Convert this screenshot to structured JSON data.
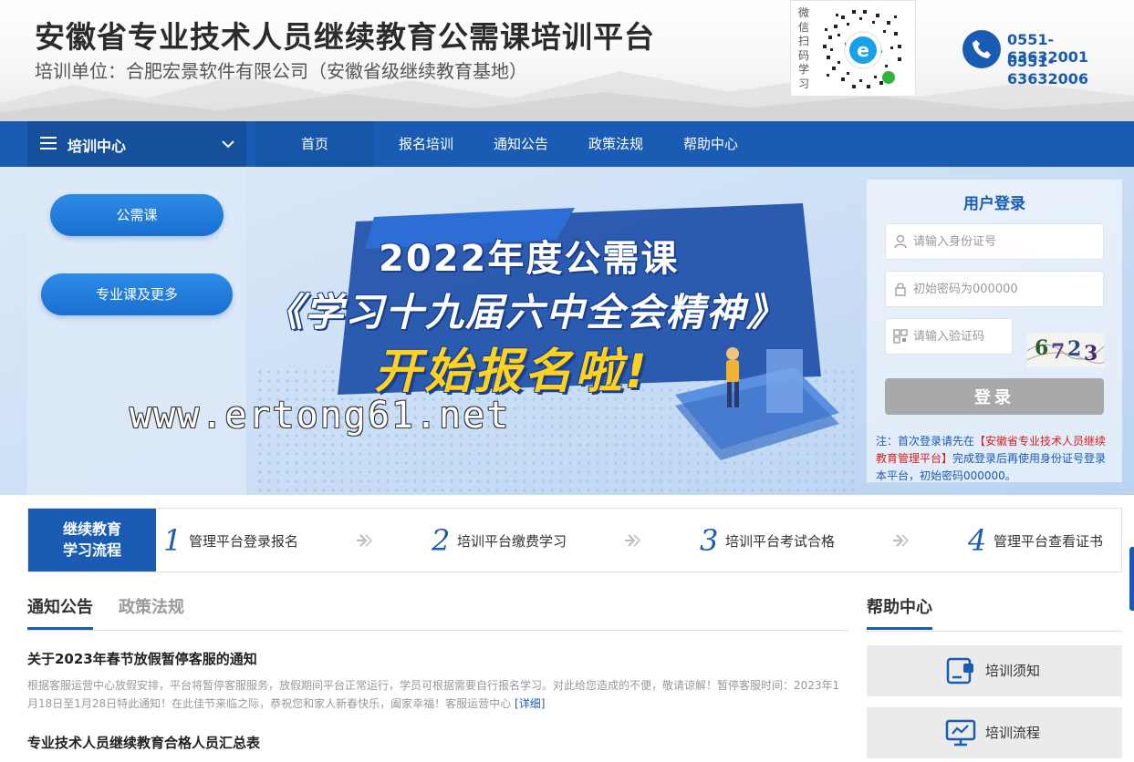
{
  "header": {
    "title": "安徽省专业技术人员继续教育公需课培训平台",
    "subtitle": "培训单位：合肥宏景软件有限公司（安徽省级继续教育基地）",
    "qr_label": "微信扫码学习",
    "phones": [
      "0551-63632001",
      "0551-63632006"
    ]
  },
  "nav": {
    "center_label": "培训中心",
    "items": [
      "首页",
      "报名培训",
      "通知公告",
      "政策法规",
      "帮助中心"
    ],
    "active": "首页"
  },
  "left_panel": {
    "buttons": [
      "公需课",
      "专业课及更多"
    ]
  },
  "banner": {
    "line1": "2022年度公需课",
    "line2": "《学习十九届六中全会精神》",
    "line3": "开始报名啦!",
    "watermark": "www.ertong61.net"
  },
  "login": {
    "title": "用户登录",
    "id_placeholder": "请输入身份证号",
    "pwd_placeholder": "初始密码为000000",
    "captcha_placeholder": "请输入验证码",
    "captcha_digits": [
      "6",
      "7",
      "2",
      "3"
    ],
    "button": "登录",
    "note_prefix": "注：首次登录请先在",
    "note_link": "【安徽省专业技术人员继续教育管理平台】",
    "note_suffix": "完成登录后再使用身份证号登录本平台，初始密码000000。"
  },
  "process": {
    "head_line1": "继续教育",
    "head_line2": "学习流程",
    "steps": [
      {
        "num": "1",
        "text": "管理平台登录报名"
      },
      {
        "num": "2",
        "text": "培训平台缴费学习"
      },
      {
        "num": "3",
        "text": "培训平台考试合格"
      },
      {
        "num": "4",
        "text": "管理平台查看证书"
      }
    ]
  },
  "news": {
    "tabs": [
      "通知公告",
      "政策法规"
    ],
    "items": [
      {
        "title": "关于2023年春节放假暂停客服的通知",
        "body": "根据客服运营中心放假安排，平台将暂停客服服务，放假期间平台正常运行，学员可根据需要自行报名学习。对此给您造成的不便，敬请谅解！暂停客服时间：2023年1月18日至1月28日特此通知！在此佳节来临之际，恭祝您和家人新春快乐，阖家幸福！客服运营中心",
        "more": "[详细]"
      },
      {
        "title": "专业技术人员继续教育合格人员汇总表"
      }
    ]
  },
  "help": {
    "title": "帮助中心",
    "cards": [
      "培训须知",
      "培训流程"
    ]
  },
  "colors": {
    "primary": "#1a5cb3",
    "login_button": "#a9a9a9",
    "highlight": "#ffd21f",
    "note_red": "#d62020"
  }
}
